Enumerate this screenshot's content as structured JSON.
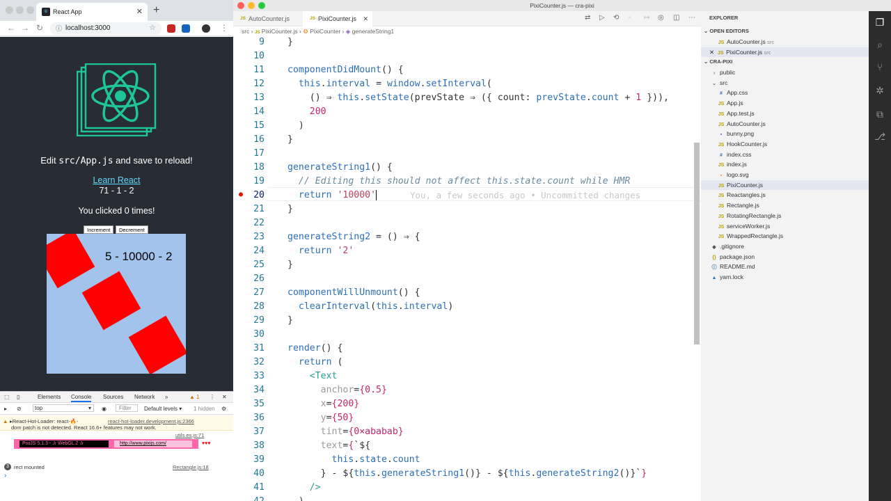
{
  "browser": {
    "tab_title": "React App",
    "url": "localhost:3000",
    "page": {
      "edit_prefix": "Edit ",
      "edit_code": "src/App.js",
      "edit_suffix": " and save to reload!",
      "learn_link": "Learn React",
      "counter_line": "71 - 1 - 2",
      "clicked_text": "You clicked 0 times!",
      "increment_label": "Increment",
      "decrement_label": "Decrement",
      "stage_text": "5 - 10000 - 2"
    },
    "devtools": {
      "tabs": [
        "Elements",
        "Console",
        "Sources",
        "Network"
      ],
      "more": "»",
      "warning_count": "1",
      "context": "top",
      "filter_placeholder": "Filter",
      "levels": "Default levels ▾",
      "hidden": "1 hidden",
      "warn_line1": "▸React-Hot-Loader: react-🔥-",
      "warn_line2": "dom patch is not detected. React 16.6+ features may not work.",
      "warn_source": "react-hot-loader.development.js:2366",
      "utils_source": "utils.es.js:71",
      "pixi_banner": "PixiJS 5.1.3 - ✰ WebGL 2 ✰",
      "pixi_url": "http://www.pixijs.com/",
      "hearts": "♥♥♥",
      "rect_count": "3",
      "rect_text": "rect mounted",
      "rect_source": "Rectangle.js:18",
      "prompt": "›"
    }
  },
  "editor": {
    "window_title": "PixiCounter.js — cra-pixi",
    "tabs": [
      {
        "label": "AutoCounter.js",
        "active": false
      },
      {
        "label": "PixiCounter.js",
        "active": true
      }
    ],
    "breadcrumb": [
      "src",
      "PixiCounter.js",
      "PixiCounter",
      "generateString1"
    ],
    "blame": "You, a few seconds ago • Uncommitted changes",
    "line_numbers": [
      "9",
      "10",
      "11",
      "12",
      "13",
      "14",
      "15",
      "16",
      "17",
      "18",
      "19",
      "20",
      "21",
      "22",
      "23",
      "24",
      "25",
      "26",
      "27",
      "28",
      "29",
      "30",
      "31",
      "32",
      "33",
      "34",
      "35",
      "36",
      "37",
      "38",
      "39",
      "40",
      "41",
      "42"
    ]
  },
  "explorer": {
    "title": "EXPLORER",
    "open_editors_header": "OPEN EDITORS",
    "open_editors": [
      {
        "name": "AutoCounter.js",
        "dir": "src"
      },
      {
        "name": "PixiCounter.js",
        "dir": "src"
      }
    ],
    "project_header": "CRA-PIXI",
    "tree": [
      {
        "name": "public",
        "type": "folder",
        "depth": 1,
        "icon": "›"
      },
      {
        "name": "src",
        "type": "folder",
        "depth": 1,
        "icon": "⌄"
      },
      {
        "name": "App.css",
        "type": "css",
        "depth": 2,
        "icon": "#"
      },
      {
        "name": "App.js",
        "type": "js",
        "depth": 2,
        "icon": "JS"
      },
      {
        "name": "App.test.js",
        "type": "js",
        "depth": 2,
        "icon": "JS"
      },
      {
        "name": "AutoCounter.js",
        "type": "js",
        "depth": 2,
        "icon": "JS"
      },
      {
        "name": "bunny.png",
        "type": "img",
        "depth": 2,
        "icon": "▪"
      },
      {
        "name": "HookCounter.js",
        "type": "js",
        "depth": 2,
        "icon": "JS"
      },
      {
        "name": "index.css",
        "type": "css",
        "depth": 2,
        "icon": "#"
      },
      {
        "name": "index.js",
        "type": "js",
        "depth": 2,
        "icon": "JS"
      },
      {
        "name": "logo.svg",
        "type": "svg",
        "depth": 2,
        "icon": "▪"
      },
      {
        "name": "PixiCounter.js",
        "type": "js",
        "depth": 2,
        "icon": "JS",
        "selected": true
      },
      {
        "name": "Reactangles.js",
        "type": "js",
        "depth": 2,
        "icon": "JS"
      },
      {
        "name": "Rectangle.js",
        "type": "js",
        "depth": 2,
        "icon": "JS"
      },
      {
        "name": "RotatingRectangle.js",
        "type": "js",
        "depth": 2,
        "icon": "JS"
      },
      {
        "name": "serviceWorker.js",
        "type": "js",
        "depth": 2,
        "icon": "JS"
      },
      {
        "name": "WrappedRectangle.js",
        "type": "js",
        "depth": 2,
        "icon": "JS"
      },
      {
        "name": ".gitignore",
        "type": "git",
        "depth": 1,
        "icon": "◆"
      },
      {
        "name": "package.json",
        "type": "json",
        "depth": 1,
        "icon": "{}"
      },
      {
        "name": "README.md",
        "type": "md",
        "depth": 1,
        "icon": "ⓘ"
      },
      {
        "name": "yarn.lock",
        "type": "lock",
        "depth": 1,
        "icon": "▲"
      }
    ]
  },
  "colors": {
    "react_bg": "#282c34",
    "react_blue": "#61dafb",
    "logo_green": "#1fc59a",
    "stage_bg": "#a2c4ec",
    "rect_red": "#ff0000"
  }
}
